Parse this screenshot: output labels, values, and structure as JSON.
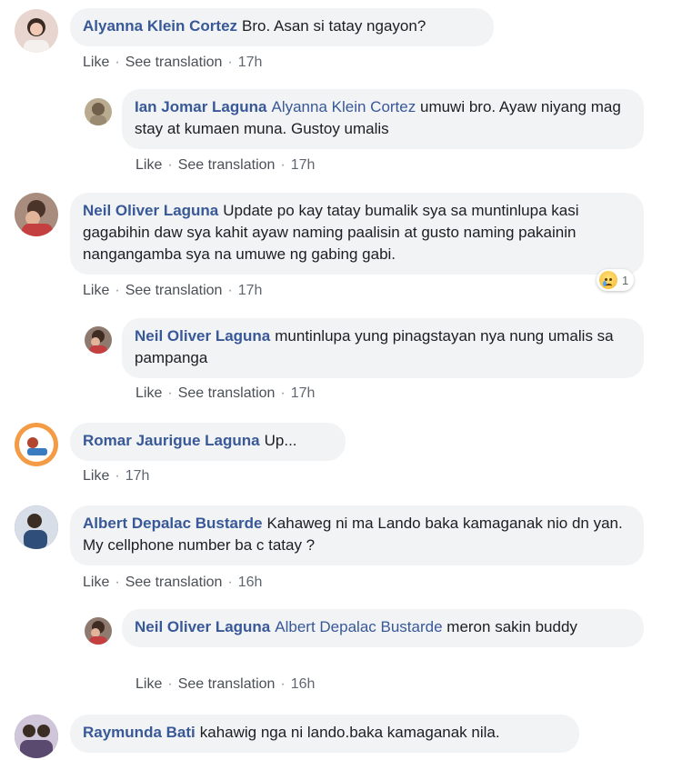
{
  "actions": {
    "like": "Like",
    "see_translation": "See translation",
    "separator": "·"
  },
  "comments": [
    {
      "author": "Alyanna Klein Cortez",
      "mention": "",
      "text": "Bro. Asan si tatay ngayon?",
      "time": "17h",
      "avatar_color": "#e8d5cf"
    },
    {
      "author": "Ian Jomar Laguna",
      "mention": "Alyanna Klein Cortez",
      "text": "umuwi bro. Ayaw niyang mag stay at kumaen muna. Gustoy umalis",
      "time": "17h",
      "avatar_color": "#b9ab8f"
    },
    {
      "author": "Neil Oliver Laguna",
      "mention": "",
      "text": "Update po kay tatay bumalik sya sa muntinlupa kasi gagabihin daw sya kahit ayaw naming paalisin at gusto naming pakainin nangangamba sya na umuwe ng gabing gabi.",
      "time": "17h",
      "avatar_color": "#a88c7d",
      "reaction_count": "1",
      "reaction_icon": "sad-reaction-icon"
    },
    {
      "author": "Neil Oliver Laguna",
      "mention": "",
      "text": "muntinlupa yung pinagstayan nya nung umalis sa pampanga",
      "time": "17h",
      "avatar_color": "#8f7a6f"
    },
    {
      "author": "Romar Jaurigue Laguna",
      "mention": "",
      "text": "Up...",
      "time": "17h",
      "avatar_color": "#f39b45"
    },
    {
      "author": "Albert Depalac Bustarde",
      "mention": "",
      "text": "Kahaweg ni ma Lando baka kamaganak nio dn yan. My cellphone number ba c tatay ?",
      "time": "16h",
      "avatar_color": "#5e6f86"
    },
    {
      "author": "Neil Oliver Laguna",
      "mention": "Albert Depalac Bustarde",
      "text": "meron sakin buddy",
      "time": "16h",
      "avatar_color": "#8f7a6f"
    },
    {
      "author": "Raymunda Bati",
      "mention": "",
      "text": "kahawig nga ni lando.baka kamaganak nila.",
      "time": "",
      "avatar_color": "#7b6a8c"
    }
  ]
}
